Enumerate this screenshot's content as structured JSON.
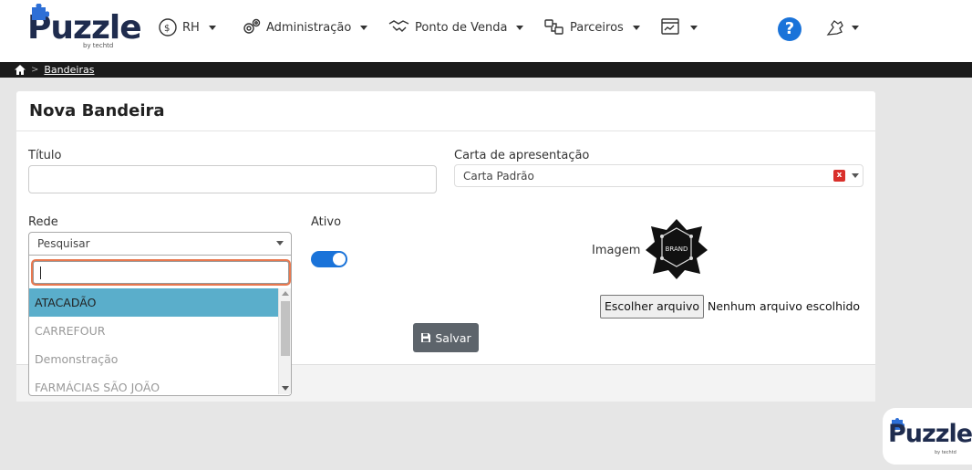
{
  "brand": {
    "name": "Puzzle",
    "tagline": "by techtd"
  },
  "nav": {
    "rh": "RH",
    "admin": "Administração",
    "pdv": "Ponto de Venda",
    "parceiros": "Parceiros"
  },
  "breadcrumb": {
    "current": "Bandeiras"
  },
  "card": {
    "title": "Nova Bandeira"
  },
  "form": {
    "titulo_label": "Título",
    "titulo_value": "",
    "carta_label": "Carta de apresentação",
    "carta_value": "Carta Padrão",
    "rede_label": "Rede",
    "rede_placeholder": "Pesquisar",
    "ativo_label": "Ativo",
    "ativo_on": true,
    "imagem_label": "Imagem",
    "image_text": "BRAND",
    "file_button": "Escolher arquivo",
    "file_status": "Nenhum arquivo escolhido",
    "save_label": "Salvar",
    "clear_mark": "x"
  },
  "dropdown": {
    "search_value": "",
    "options": [
      "ATACADÃO",
      "CARREFOUR",
      "Demonstração",
      "FARMÁCIAS SÃO JOÃO"
    ],
    "highlighted": "ATACADÃO"
  },
  "help": {
    "glyph": "?"
  },
  "colors": {
    "accent": "#1a73d9",
    "highlight": "#5aaecb",
    "focus": "#e8784f",
    "brand": "#1f2c4e"
  }
}
